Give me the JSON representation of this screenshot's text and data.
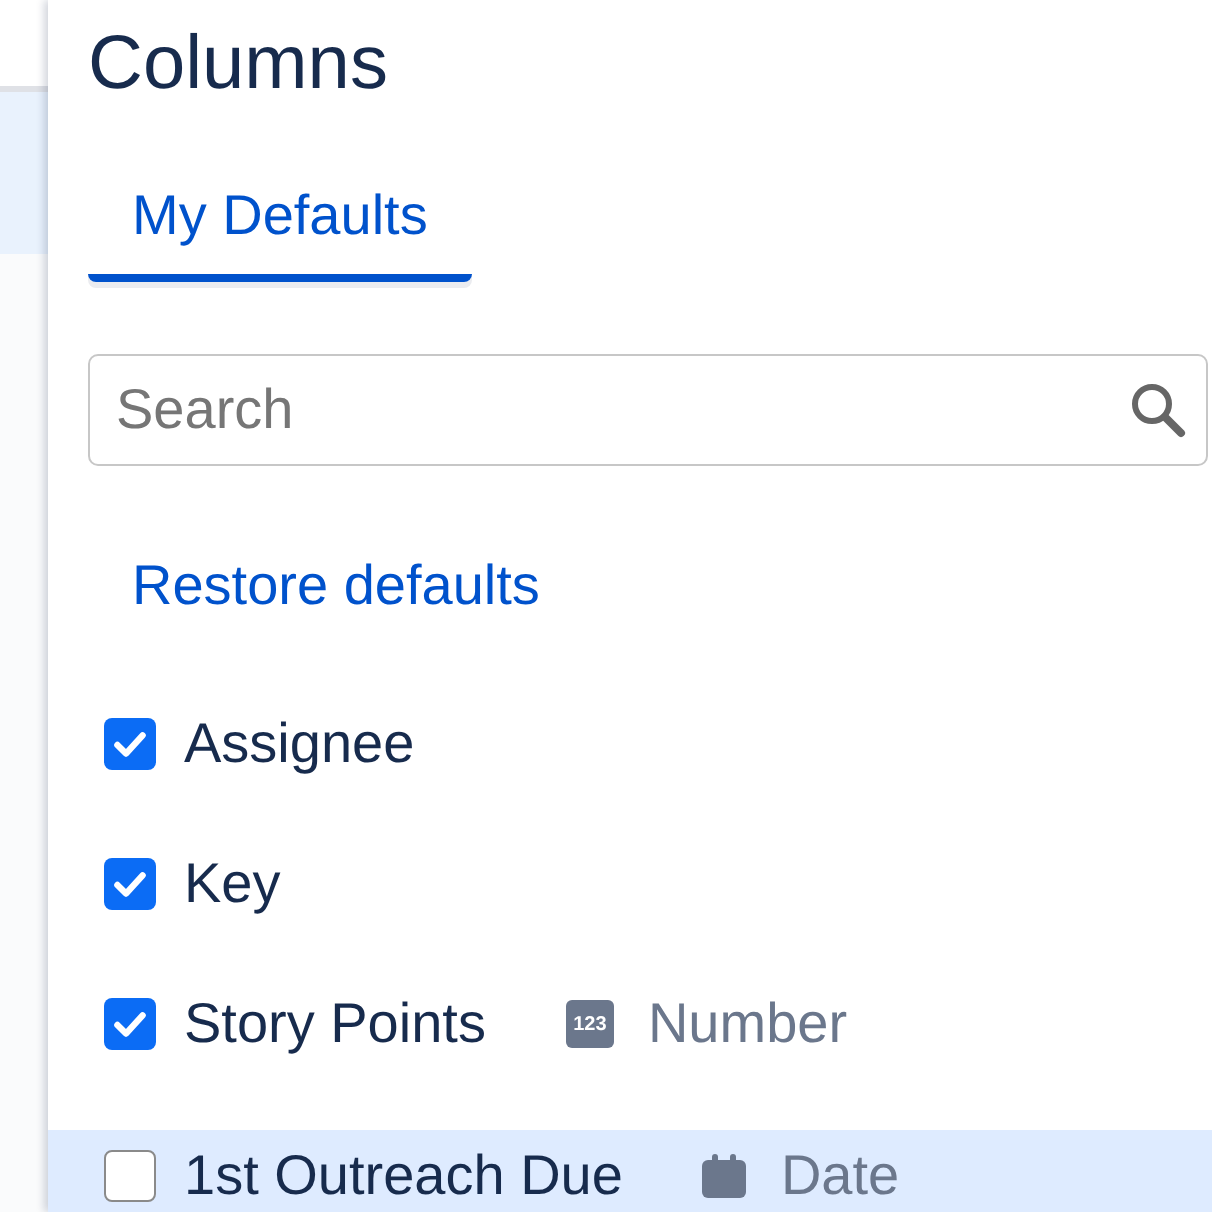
{
  "panel": {
    "title": "Columns"
  },
  "tabs": [
    {
      "label": "My Defaults",
      "selected": true
    }
  ],
  "search": {
    "placeholder": "Search"
  },
  "restore_link": "Restore defaults",
  "columns": [
    {
      "label": "Assignee",
      "checked": true,
      "hovered": false
    },
    {
      "label": "Key",
      "checked": true,
      "hovered": false
    },
    {
      "label": "Story Points",
      "checked": true,
      "hovered": false,
      "type": {
        "kind": "number",
        "badge": "123",
        "label": "Number"
      }
    },
    {
      "label": "1st Outreach Due",
      "checked": false,
      "hovered": true,
      "type": {
        "kind": "date",
        "label": "Date"
      }
    }
  ]
}
